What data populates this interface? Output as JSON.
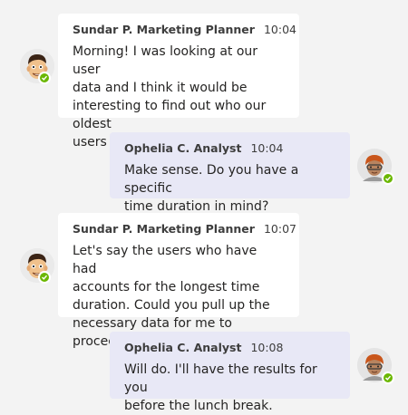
{
  "messages": [
    {
      "sender": "Sundar P. Marketing Planner",
      "time": "10:04",
      "lines": [
        "Morning! I was looking at our user",
        "data and I think it would be",
        "interesting to find out who our oldest",
        "users are."
      ],
      "direction": "incoming",
      "avatar_icon": "man-avatar-icon",
      "presence": "available"
    },
    {
      "sender": "Ophelia C. Analyst",
      "time": "10:04",
      "lines": [
        "Make sense. Do you have a specific",
        "time duration in mind?"
      ],
      "direction": "outgoing",
      "avatar_icon": "woman-avatar-icon",
      "presence": "available"
    },
    {
      "sender": "Sundar P. Marketing Planner",
      "time": "10:07",
      "lines": [
        "Let's say the users who have had",
        "accounts for the longest time",
        "duration. Could you pull up the",
        "necessary data for me to proceed?"
      ],
      "direction": "incoming",
      "avatar_icon": "man-avatar-icon",
      "presence": "available"
    },
    {
      "sender": "Ophelia C. Analyst",
      "time": "10:08",
      "lines": [
        "Will do. I'll have the results for you",
        "before the lunch break."
      ],
      "direction": "outgoing",
      "avatar_icon": "woman-avatar-icon",
      "presence": "available"
    }
  ],
  "colors": {
    "background": "#f3f3f3",
    "incoming_bubble": "#ffffff",
    "outgoing_bubble": "#e8e8f6",
    "presence_available": "#6bb700"
  }
}
